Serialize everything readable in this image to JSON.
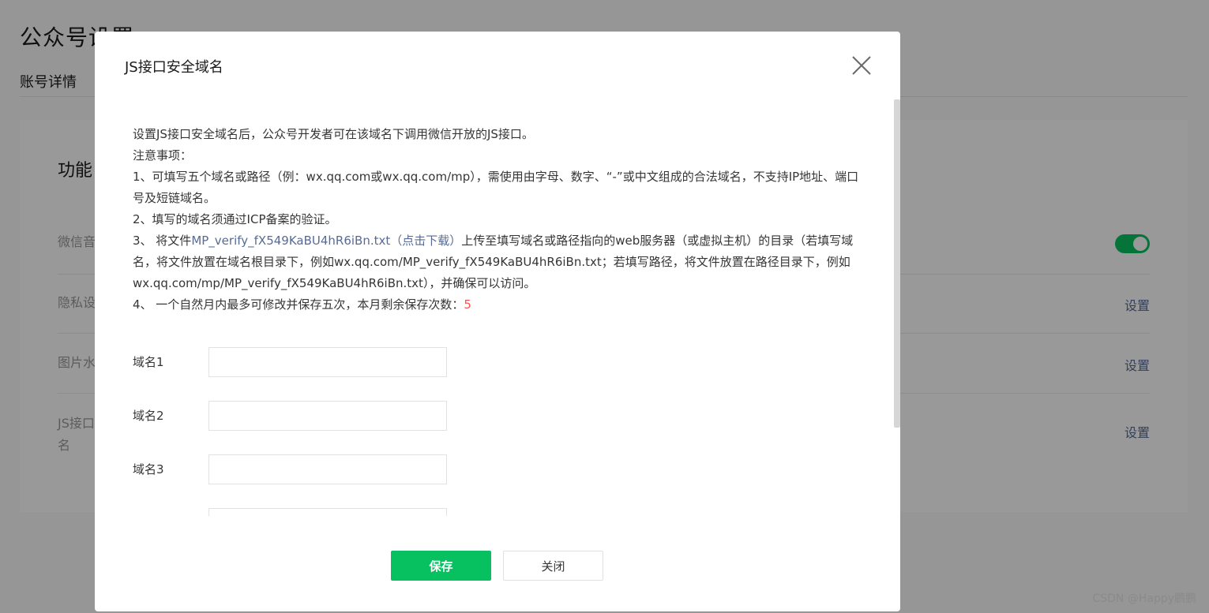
{
  "background": {
    "page_title": "公众号设置",
    "tab_active": "账号详情",
    "card_title": "功能",
    "rows": [
      {
        "label": "微信音",
        "action": ""
      },
      {
        "label": "隐私设",
        "action": "设置"
      },
      {
        "label": "图片水",
        "action": "设置"
      },
      {
        "label": "JS接口\n名",
        "action": "设置"
      }
    ]
  },
  "dialog": {
    "title": "JS接口安全域名",
    "desc_line1": "设置JS接口安全域名后，公众号开发者可在该域名下调用微信开放的JS接口。",
    "notes_title": "注意事项：",
    "note1": "1、可填写五个域名或路径（例：wx.qq.com或wx.qq.com/mp），需使用由字母、数字、“-”或中文组成的合法域名，不支持IP地址、端口号及短链域名。",
    "note2": "2、填写的域名须通过ICP备案的验证。",
    "note3_prefix": "3、 将文件",
    "note3_link": "MP_verify_fX549KaBU4hR6iBn.txt（点击下载）",
    "note3_suffix": "上传至填写域名或路径指向的web服务器（或虚拟主机）的目录（若填写域名，将文件放置在域名根目录下，例如wx.qq.com/MP_verify_fX549KaBU4hR6iBn.txt；若填写路径，将文件放置在路径目录下，例如wx.qq.com/mp/MP_verify_fX549KaBU4hR6iBn.txt），并确保可以访问。",
    "note4_prefix": "4、 一个自然月内最多可修改并保存五次，本月剩余保存次数：",
    "note4_count": "5",
    "fields": [
      {
        "label": "域名1",
        "value": ""
      },
      {
        "label": "域名2",
        "value": ""
      },
      {
        "label": "域名3",
        "value": ""
      }
    ],
    "save_label": "保存",
    "close_label": "关闭"
  },
  "watermark": "CSDN @Happy鹏鹏",
  "colors": {
    "primary": "#07c160",
    "link": "#576b95",
    "red": "#fa5151"
  }
}
